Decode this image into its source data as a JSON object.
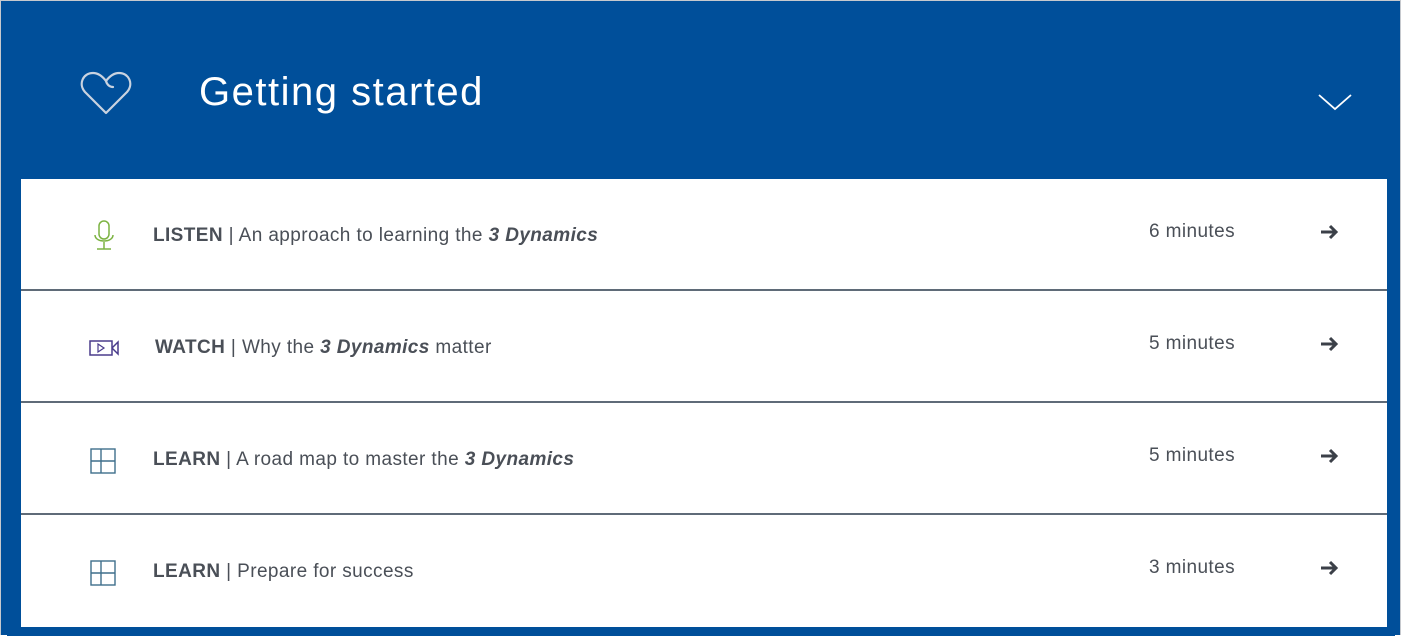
{
  "section": {
    "title": "Getting started",
    "icon": "heart-outline-icon",
    "toggle_icon": "chevron-down-icon"
  },
  "items": [
    {
      "type": "LISTEN",
      "separator": " | ",
      "text_before": "An approach to learning the ",
      "emphasis": "3 Dynamics",
      "text_after": "",
      "duration": "6 minutes",
      "icon": "microphone-icon",
      "icon_color": "#7cb342"
    },
    {
      "type": "WATCH",
      "separator": " | ",
      "text_before": "Why the ",
      "emphasis": "3 Dynamics",
      "text_after": " matter",
      "duration": "5 minutes",
      "icon": "video-camera-icon",
      "icon_color": "#4a3c8c"
    },
    {
      "type": "LEARN",
      "separator": " | ",
      "text_before": "A road map to master the ",
      "emphasis": "3 Dynamics",
      "text_after": "",
      "duration": "5 minutes",
      "icon": "layout-grid-icon",
      "icon_color": "#3f6f8c"
    },
    {
      "type": "LEARN",
      "separator": " | ",
      "text_before": "Prepare for success",
      "emphasis": "",
      "text_after": "",
      "duration": "3 minutes",
      "icon": "layout-grid-icon",
      "icon_color": "#3f6f8c"
    }
  ],
  "colors": {
    "header_bg": "#004f9a",
    "text": "#4a4f57",
    "divider": "#5f6b78"
  }
}
